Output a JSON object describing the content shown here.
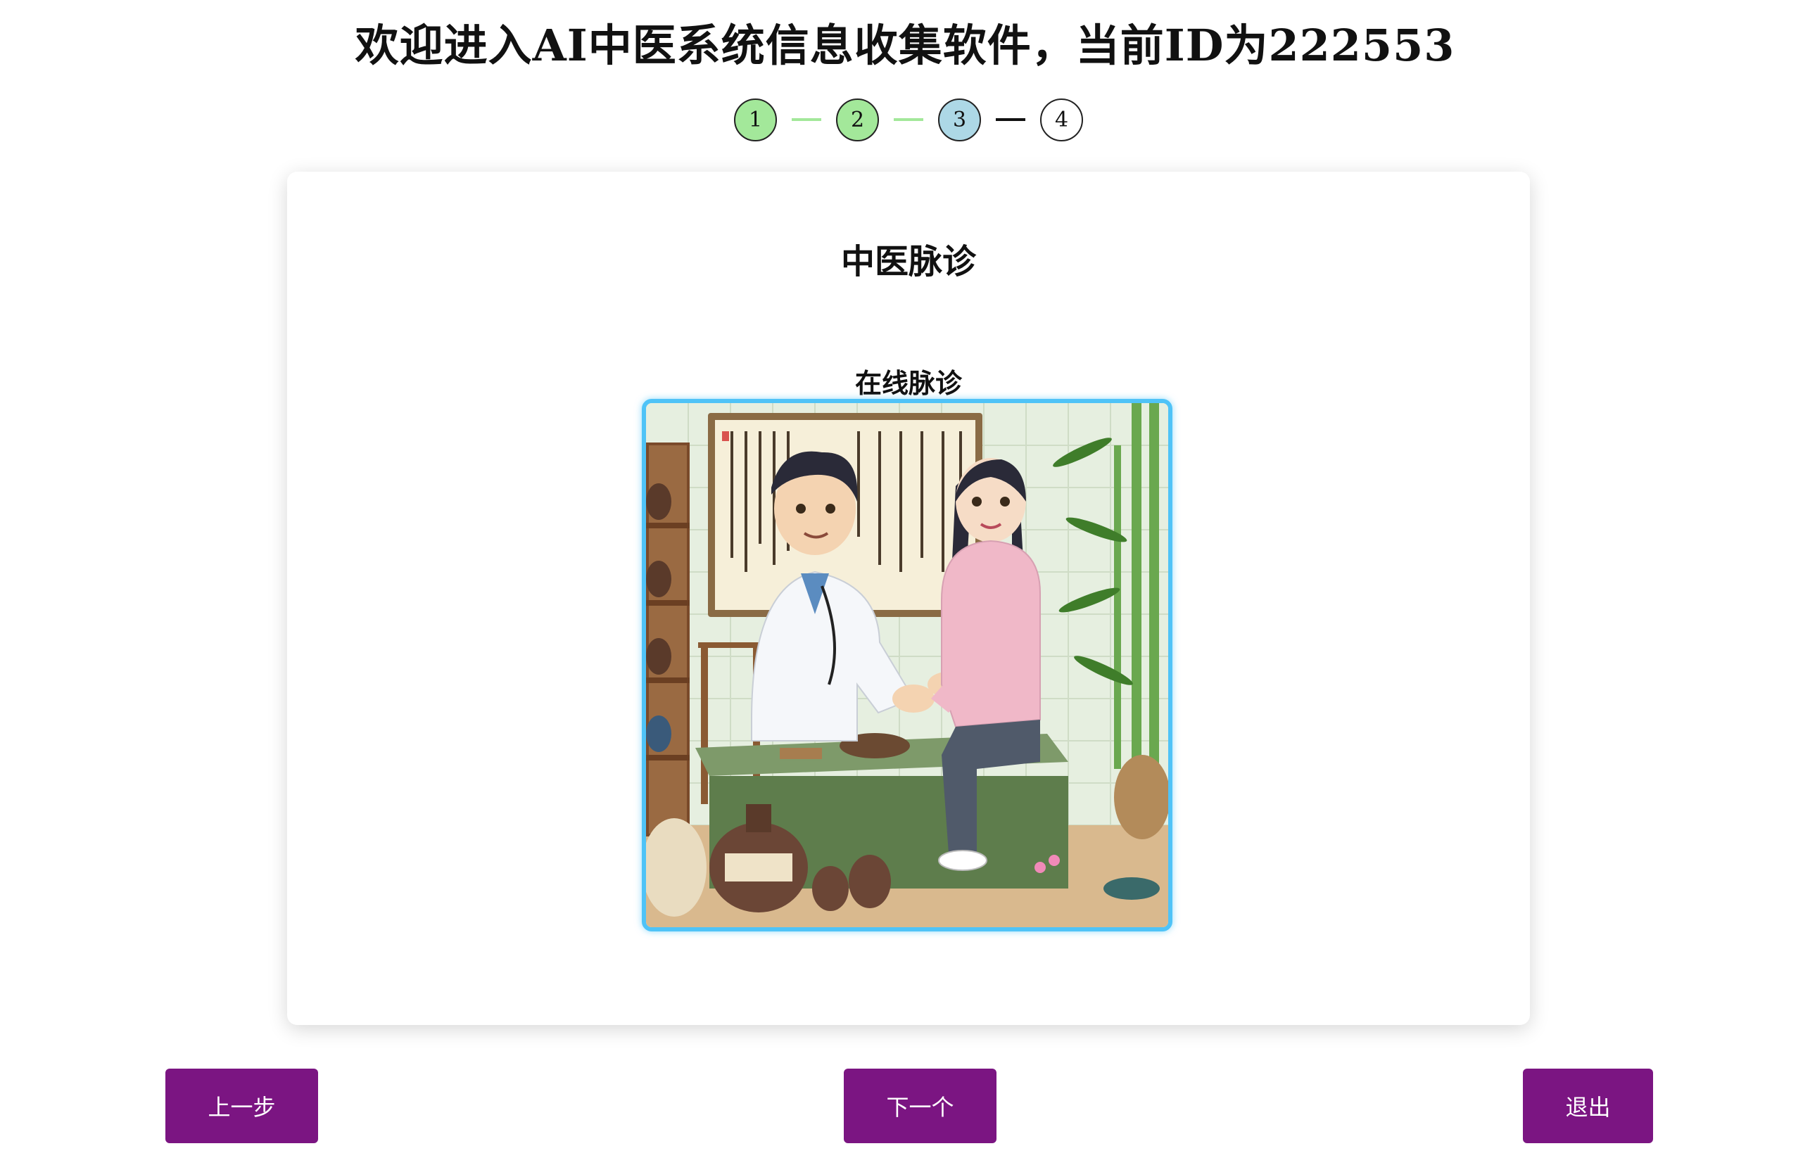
{
  "header": {
    "title": "欢迎进入AI中医系统信息收集软件，当前ID为222553"
  },
  "stepper": {
    "steps": [
      "1",
      "2",
      "3",
      "4"
    ],
    "current_step": 3,
    "colors": {
      "done": "#a3e89a",
      "current": "#add8e6",
      "pending": "#ffffff"
    }
  },
  "card": {
    "title": "中医脉诊",
    "subtitle": "在线脉诊",
    "image_icon": "pulse-diagnosis-illustration"
  },
  "buttons": {
    "prev_label": "上一步",
    "next_label": "下一个",
    "exit_label": "退出",
    "color": "#7b1582"
  }
}
